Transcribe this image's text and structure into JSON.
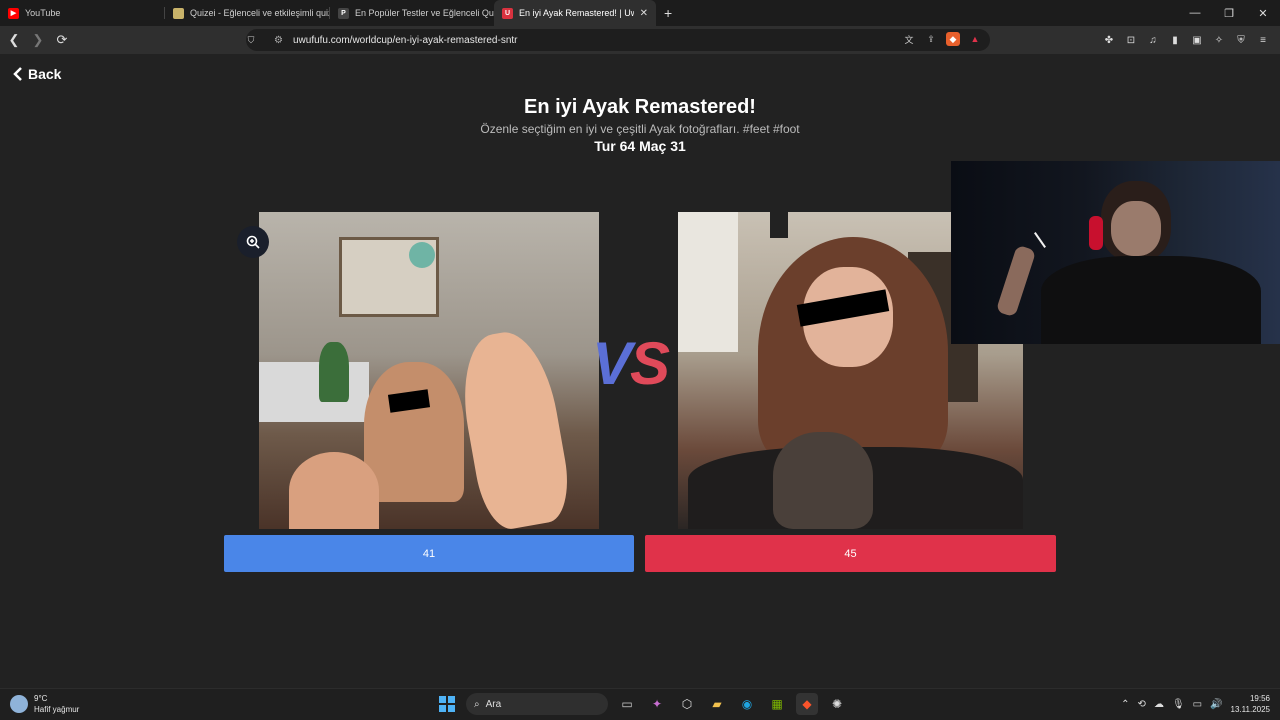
{
  "browser": {
    "tabs": [
      {
        "label": "YouTube",
        "icon": "youtube-icon",
        "color": "#ff0000"
      },
      {
        "label": "Quizei - Eğlenceli ve etkileşimli quizle",
        "icon": "quizei-icon",
        "color": "#c9b36a"
      },
      {
        "label": "En Popüler Testler ve Eğlenceli Quizle",
        "icon": "p-icon",
        "color": "#444444"
      },
      {
        "label": "En iyi Ayak Remastered! | UwUFU",
        "icon": "uwufufu-icon",
        "color": "#d9323f"
      }
    ],
    "url": "uwufufu.com/worldcup/en-iyi-ayak-remastered-sntr"
  },
  "page": {
    "back_label": "Back",
    "title": "En iyi Ayak Remastered!",
    "subtitle": "Özenle seçtiğim en iyi ve çeşitli Ayak fotoğrafları. #feet #foot",
    "round": "Tur 64 Maç 31",
    "vs_v": "V",
    "vs_s": "S",
    "left_choice": "41",
    "right_choice": "45",
    "colors": {
      "left": "#4a86e8",
      "right": "#e0324a",
      "vs_v": "#5b6fd6",
      "vs_s": "#e04a5a"
    }
  },
  "taskbar": {
    "temperature": "9°C",
    "weather": "Hafif yağmur",
    "search_placeholder": "Ara",
    "time": "19:56",
    "date": "13.11.2025"
  }
}
